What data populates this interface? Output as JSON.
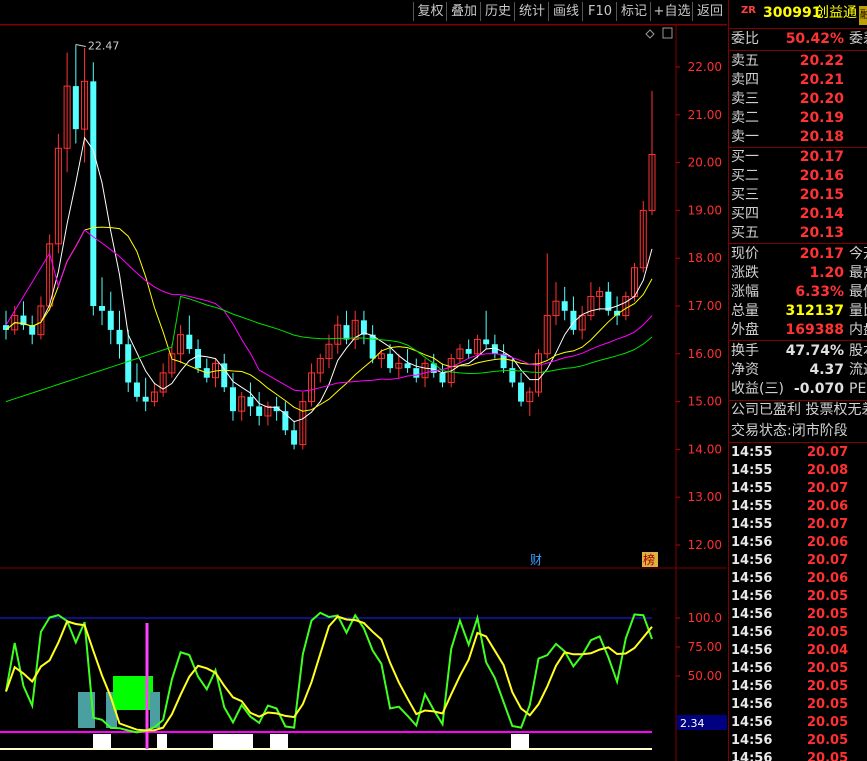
{
  "toolbar": {
    "buttons": [
      "复权",
      "叠加",
      "历史",
      "统计",
      "画线",
      "F10",
      "标记",
      "+自选",
      "返回"
    ]
  },
  "chart": {
    "high_marker": "22.47",
    "price_axis": [
      "22.00",
      "21.00",
      "20.00",
      "19.00",
      "18.00",
      "17.00",
      "16.00",
      "15.00",
      "14.00",
      "13.00",
      "12.00"
    ],
    "indicator_axis": [
      "100.0",
      "75.00",
      "50.00"
    ],
    "indicator_readout": "2.34",
    "badges": {
      "cai": "财",
      "bang": "榜"
    },
    "colors": {
      "up": "#ff3232",
      "down": "#54ffff",
      "ma5": "#ffffff",
      "ma10": "#ffff00",
      "ma20": "#ff00ff",
      "ma60": "#00e000",
      "grid": "#800000"
    }
  },
  "chart_data": {
    "type": "candlestick",
    "ylim": [
      11.5,
      23.0
    ],
    "candles": [
      [
        16.6,
        16.9,
        16.3,
        16.5
      ],
      [
        16.5,
        17.0,
        16.4,
        16.8
      ],
      [
        16.8,
        17.1,
        16.5,
        16.6
      ],
      [
        16.6,
        16.8,
        16.2,
        16.4
      ],
      [
        16.4,
        17.2,
        16.3,
        17.0
      ],
      [
        17.0,
        18.5,
        16.9,
        18.3
      ],
      [
        18.3,
        20.6,
        18.1,
        20.3
      ],
      [
        20.3,
        22.3,
        19.8,
        21.6
      ],
      [
        21.6,
        22.47,
        20.4,
        20.7
      ],
      [
        20.7,
        22.4,
        20.0,
        21.7
      ],
      [
        21.7,
        22.1,
        16.8,
        17.0
      ],
      [
        17.0,
        17.6,
        16.6,
        16.9
      ],
      [
        16.9,
        17.3,
        16.2,
        16.5
      ],
      [
        16.5,
        16.9,
        15.9,
        16.2
      ],
      [
        16.2,
        16.5,
        15.2,
        15.4
      ],
      [
        15.4,
        15.8,
        15.0,
        15.1
      ],
      [
        15.1,
        15.5,
        14.8,
        15.0
      ],
      [
        15.0,
        15.4,
        14.9,
        15.2
      ],
      [
        15.2,
        15.8,
        15.1,
        15.6
      ],
      [
        15.6,
        16.2,
        15.5,
        16.0
      ],
      [
        16.0,
        16.6,
        15.8,
        16.4
      ],
      [
        16.4,
        16.8,
        16.0,
        16.1
      ],
      [
        16.1,
        16.3,
        15.6,
        15.7
      ],
      [
        15.7,
        15.9,
        15.4,
        15.5
      ],
      [
        15.5,
        15.9,
        15.3,
        15.8
      ],
      [
        15.8,
        16.0,
        15.2,
        15.3
      ],
      [
        15.3,
        15.6,
        14.6,
        14.8
      ],
      [
        14.8,
        15.2,
        14.6,
        15.1
      ],
      [
        15.1,
        15.4,
        14.7,
        14.9
      ],
      [
        14.9,
        15.2,
        14.5,
        14.7
      ],
      [
        14.7,
        15.0,
        14.5,
        14.9
      ],
      [
        14.9,
        15.1,
        14.6,
        14.8
      ],
      [
        14.8,
        15.0,
        14.3,
        14.4
      ],
      [
        14.4,
        14.6,
        14.0,
        14.1
      ],
      [
        14.1,
        15.2,
        14.0,
        15.0
      ],
      [
        15.0,
        15.8,
        14.9,
        15.6
      ],
      [
        15.6,
        16.0,
        15.4,
        15.9
      ],
      [
        15.9,
        16.4,
        15.7,
        16.2
      ],
      [
        16.2,
        16.8,
        16.0,
        16.6
      ],
      [
        16.6,
        16.9,
        16.2,
        16.3
      ],
      [
        16.3,
        16.9,
        16.1,
        16.7
      ],
      [
        16.7,
        16.9,
        16.2,
        16.4
      ],
      [
        16.4,
        16.6,
        15.8,
        15.9
      ],
      [
        15.9,
        16.1,
        15.7,
        16.0
      ],
      [
        16.0,
        16.2,
        15.6,
        15.7
      ],
      [
        15.7,
        16.0,
        15.5,
        15.8
      ],
      [
        15.8,
        16.1,
        15.6,
        15.7
      ],
      [
        15.7,
        15.9,
        15.4,
        15.5
      ],
      [
        15.5,
        15.9,
        15.3,
        15.8
      ],
      [
        15.8,
        16.0,
        15.5,
        15.6
      ],
      [
        15.6,
        15.8,
        15.3,
        15.4
      ],
      [
        15.4,
        16.0,
        15.3,
        15.9
      ],
      [
        15.9,
        16.2,
        15.8,
        16.1
      ],
      [
        16.1,
        16.3,
        15.9,
        16.0
      ],
      [
        16.0,
        16.4,
        15.9,
        16.3
      ],
      [
        16.3,
        16.9,
        16.1,
        16.2
      ],
      [
        16.2,
        16.4,
        15.9,
        16.0
      ],
      [
        16.0,
        16.2,
        15.6,
        15.7
      ],
      [
        15.7,
        15.9,
        15.3,
        15.4
      ],
      [
        15.4,
        15.6,
        14.9,
        15.0
      ],
      [
        15.0,
        15.3,
        14.7,
        15.2
      ],
      [
        15.2,
        16.1,
        15.1,
        16.0
      ],
      [
        16.0,
        18.1,
        15.9,
        16.8
      ],
      [
        16.8,
        17.5,
        16.6,
        17.1
      ],
      [
        17.1,
        17.4,
        16.7,
        16.9
      ],
      [
        16.9,
        17.2,
        16.4,
        16.5
      ],
      [
        16.5,
        17.0,
        16.3,
        16.8
      ],
      [
        16.8,
        17.5,
        16.7,
        17.2
      ],
      [
        17.2,
        17.4,
        16.9,
        17.3
      ],
      [
        17.3,
        17.5,
        16.8,
        16.9
      ],
      [
        16.9,
        17.2,
        16.6,
        16.8
      ],
      [
        16.8,
        17.3,
        16.7,
        17.2
      ],
      [
        17.2,
        17.9,
        17.1,
        17.8
      ],
      [
        17.8,
        19.2,
        17.7,
        19.0
      ],
      [
        19.0,
        21.5,
        18.9,
        20.17
      ]
    ],
    "indicator_ylim": [
      0,
      115
    ]
  },
  "quote": {
    "code_prefix": "ZR",
    "code": "300991",
    "name": "创益通",
    "tag": "融",
    "weibi_label": "委比",
    "weibi": "50.42%",
    "weibi_ext": "委差",
    "asks": [
      {
        "label": "卖五",
        "price": "20.22"
      },
      {
        "label": "卖四",
        "price": "20.21"
      },
      {
        "label": "卖三",
        "price": "20.20"
      },
      {
        "label": "卖二",
        "price": "20.19"
      },
      {
        "label": "卖一",
        "price": "20.18"
      }
    ],
    "bids": [
      {
        "label": "买一",
        "price": "20.17"
      },
      {
        "label": "买二",
        "price": "20.16"
      },
      {
        "label": "买三",
        "price": "20.15"
      },
      {
        "label": "买四",
        "price": "20.14"
      },
      {
        "label": "买五",
        "price": "20.13"
      }
    ],
    "stats1": [
      {
        "label": "现价",
        "value": "20.17",
        "ext": "今开"
      },
      {
        "label": "涨跌",
        "value": "1.20",
        "ext": "最高"
      },
      {
        "label": "涨幅",
        "value": "6.33%",
        "ext": "最低"
      },
      {
        "label": "总量",
        "value": "312137",
        "ext": "量比"
      },
      {
        "label": "外盘",
        "value": "169388",
        "ext": "内盘"
      }
    ],
    "stats2": [
      {
        "label": "换手",
        "value": "47.74%",
        "ext": "股本"
      },
      {
        "label": "净资",
        "value": "4.37",
        "ext": "流通"
      },
      {
        "label": "收益(三)",
        "value": "-0.070",
        "ext": "PE(动)"
      }
    ],
    "company_note": "公司已盈利 投票权无差异",
    "trade_state": "交易状态:闭市阶段",
    "ticks": [
      {
        "time": "14:55",
        "price": "20.07"
      },
      {
        "time": "14:55",
        "price": "20.08"
      },
      {
        "time": "14:55",
        "price": "20.07"
      },
      {
        "time": "14:55",
        "price": "20.06"
      },
      {
        "time": "14:55",
        "price": "20.07"
      },
      {
        "time": "14:56",
        "price": "20.06"
      },
      {
        "time": "14:56",
        "price": "20.07"
      },
      {
        "time": "14:56",
        "price": "20.06"
      },
      {
        "time": "14:56",
        "price": "20.05"
      },
      {
        "time": "14:56",
        "price": "20.05"
      },
      {
        "time": "14:56",
        "price": "20.05"
      },
      {
        "time": "14:56",
        "price": "20.04"
      },
      {
        "time": "14:56",
        "price": "20.05"
      },
      {
        "time": "14:56",
        "price": "20.05"
      },
      {
        "time": "14:56",
        "price": "20.05"
      },
      {
        "time": "14:56",
        "price": "20.05"
      },
      {
        "time": "14:56",
        "price": "20.05"
      },
      {
        "time": "14:56",
        "price": "20.05"
      }
    ]
  }
}
